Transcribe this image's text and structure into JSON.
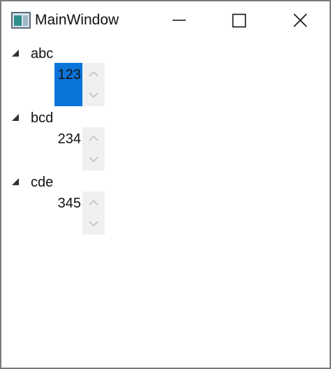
{
  "window": {
    "title": "MainWindow",
    "icon": "app-window-icon"
  },
  "caption_buttons": {
    "minimize": "minimize-icon",
    "maximize": "maximize-icon",
    "close": "close-icon"
  },
  "tree": {
    "nodes": [
      {
        "label": "abc",
        "value": "123",
        "selected": true
      },
      {
        "label": "bcd",
        "value": "234",
        "selected": false
      },
      {
        "label": "cde",
        "value": "345",
        "selected": false
      }
    ]
  },
  "colors": {
    "selection": "#0a74da",
    "spinner_bg": "#f0f0f0",
    "border": "#7a7a7a"
  }
}
